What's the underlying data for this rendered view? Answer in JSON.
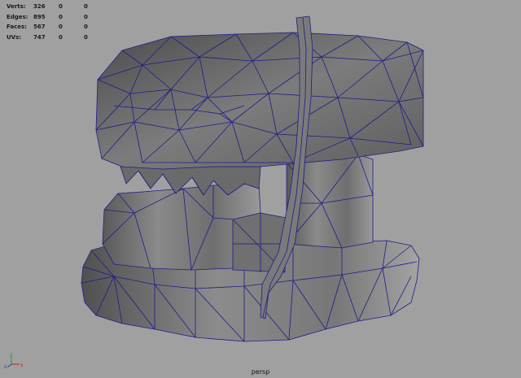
{
  "viewport": {
    "camera_label": "persp",
    "background": "#a0a0a0",
    "wire_color": "#1c1c8c"
  },
  "hud": [
    {
      "label": "Verts:",
      "v1": "326",
      "v2": "0",
      "v3": "0"
    },
    {
      "label": "Edges:",
      "v1": "895",
      "v2": "0",
      "v3": "0"
    },
    {
      "label": "Faces:",
      "v1": "567",
      "v2": "0",
      "v3": "0"
    },
    {
      "label": "UVs:",
      "v1": "747",
      "v2": "0",
      "v3": "0"
    }
  ],
  "axis": {
    "x": "x",
    "y": "y",
    "z": "z"
  }
}
